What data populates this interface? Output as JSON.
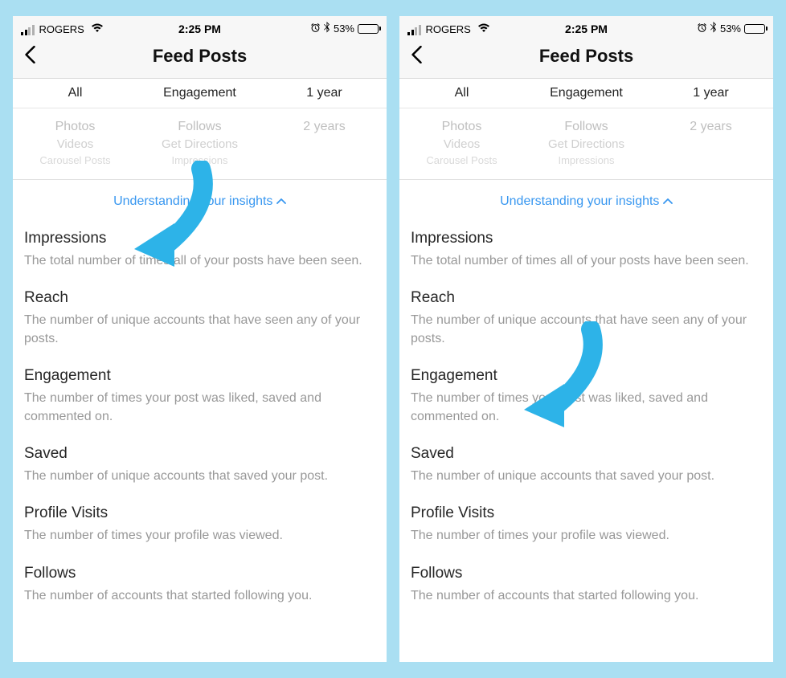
{
  "status_bar": {
    "carrier": "ROGERS",
    "time": "2:25 PM",
    "battery_pct": "53%"
  },
  "header": {
    "title": "Feed Posts"
  },
  "filter": {
    "c1": "All",
    "c2": "Engagement",
    "c3": "1 year"
  },
  "picker": {
    "col1_a": "Photos",
    "col1_b": "Videos",
    "col1_c": "Carousel Posts",
    "col2_a": "Follows",
    "col2_b": "Get Directions",
    "col2_c": "Impressions",
    "col3_a": "2 years"
  },
  "insights_link": "Understanding your insights",
  "insights": [
    {
      "title": "Impressions",
      "desc": "The total number of times all of your posts have been seen."
    },
    {
      "title": "Reach",
      "desc": "The number of unique accounts that have seen any of your posts."
    },
    {
      "title": "Engagement",
      "desc": "The number of times your post was liked, saved and commented on."
    },
    {
      "title": "Saved",
      "desc": "The number of unique accounts that saved your post."
    },
    {
      "title": "Profile Visits",
      "desc": "The number of times your profile was viewed."
    },
    {
      "title": "Follows",
      "desc": "The number of accounts that started following you."
    }
  ]
}
